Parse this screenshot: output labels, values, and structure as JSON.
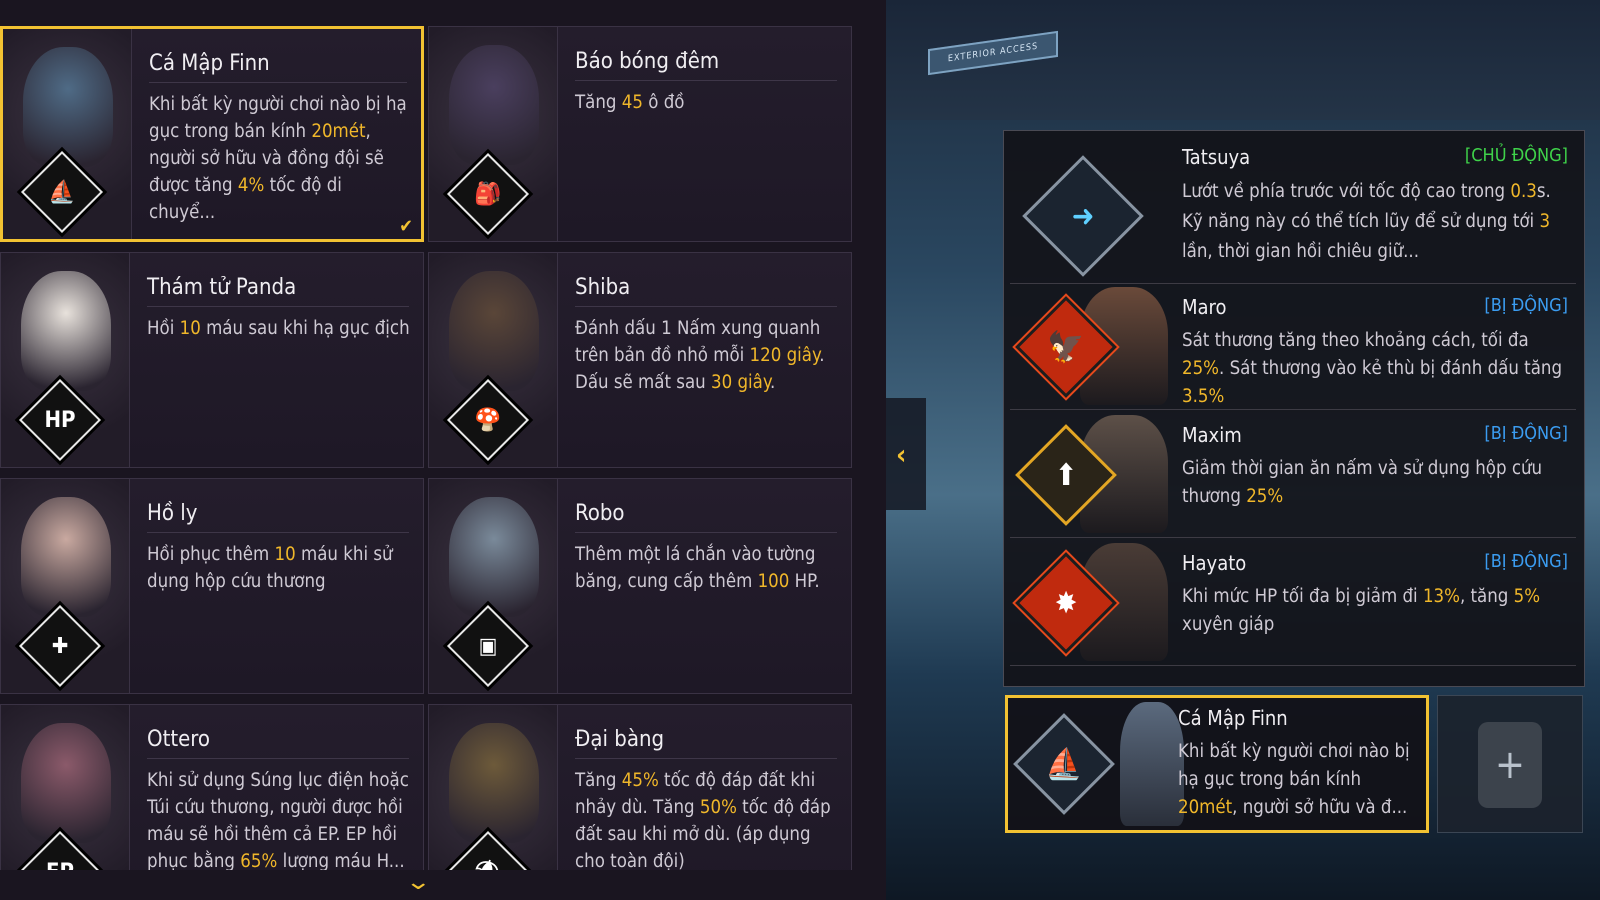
{
  "pets": [
    {
      "name": "Cá Mập Finn",
      "desc_parts": [
        "Khi bất kỳ người chơi nào bị hạ gục trong bán kính ",
        "20mét",
        ", người sở hữu và đồng đội sẽ được tăng ",
        "4%",
        " tốc độ di chuyể..."
      ],
      "icon": "shark-fin-icon",
      "selected": true
    },
    {
      "name": "Báo bóng đêm",
      "desc_parts": [
        "Tăng ",
        "45",
        " ô đồ"
      ],
      "icon": "backpack-icon",
      "selected": false
    },
    {
      "name": "Thám tử Panda",
      "desc_parts": [
        "Hồi ",
        "10",
        " máu sau khi hạ gục địch"
      ],
      "icon": "hp-heal-icon",
      "selected": false
    },
    {
      "name": "Shiba",
      "desc_parts": [
        "Đánh dấu 1 Nấm xung quanh trên bản đồ nhỏ mỗi ",
        "120 giây",
        ". Dấu sẽ mất sau ",
        "30 giây",
        "."
      ],
      "icon": "mushroom-icon",
      "selected": false
    },
    {
      "name": "Hồ ly",
      "desc_parts": [
        "Hồi phục thêm ",
        "10",
        " máu khi sử dụng hộp cứu thương"
      ],
      "icon": "medkit-icon",
      "selected": false
    },
    {
      "name": "Robo",
      "desc_parts": [
        "Thêm một lá chắn vào tường băng, cung cấp thêm ",
        "100",
        " HP."
      ],
      "icon": "gloo-wall-icon",
      "selected": false
    },
    {
      "name": "Ottero",
      "desc_parts": [
        "Khi sử dụng Súng lục điện hoặc Túi cứu thương, người được hồi máu sẽ hồi thêm cả EP. EP hồi phục bằng ",
        "65%",
        " lượng máu H..."
      ],
      "icon": "ep-icon",
      "selected": false
    },
    {
      "name": "Đại bàng",
      "desc_parts": [
        "Tăng ",
        "45%",
        " tốc độ đáp đất khi nhảy dù. Tăng ",
        "50%",
        " tốc độ đáp đất sau khi mở dù. (áp dụng cho toàn đội)"
      ],
      "icon": "parachute-icon",
      "selected": false
    }
  ],
  "skills": [
    {
      "name": "Tatsuya",
      "type": "[CHỦ ĐỘNG]",
      "kind": "active",
      "desc_parts": [
        "Lướt về phía trước với tốc độ cao trong ",
        "0.3",
        "s. Kỹ năng này có thể tích lũy để sử dụng tới ",
        "3",
        " lần, thời gian hồi chiêu giữ..."
      ],
      "icon": "dash-icon"
    },
    {
      "name": "Maro",
      "type": "[BỊ ĐỘNG]",
      "kind": "passive",
      "desc_parts": [
        "Sát thương tăng theo khoảng cách, tối đa ",
        "25%",
        ". Sát thương vào kẻ thù bị đánh dấu tăng ",
        "3.5%"
      ],
      "icon": "falcon-icon"
    },
    {
      "name": "Maxim",
      "type": "[BỊ ĐỘNG]",
      "kind": "passive",
      "desc_parts": [
        "Giảm thời gian ăn nấm và sử dụng hộp cứu thương ",
        "25%"
      ],
      "icon": "eat-icon"
    },
    {
      "name": "Hayato",
      "type": "[BỊ ĐỘNG]",
      "kind": "passive",
      "desc_parts": [
        "Khi mức HP tối đa bị giảm đi ",
        "13%",
        ", tăng ",
        "5%",
        " xuyên giáp"
      ],
      "icon": "armor-pierce-icon"
    }
  ],
  "equipped": {
    "name": "Cá Mập Finn",
    "desc_parts": [
      "Khi bất kỳ người chơi nào bị hạ gục trong bán kính ",
      "20mét",
      ", người sở hữu và đ..."
    ],
    "icon": "shark-fin-icon"
  },
  "scene": {
    "sign": "EXTERIOR ACCESS"
  },
  "add_slot": {
    "symbol": "+"
  },
  "colors": {
    "highlight": "#f0b72a",
    "selected_border": "#f2c232",
    "active": "#3fd24a",
    "passive": "#3b9cf0"
  }
}
